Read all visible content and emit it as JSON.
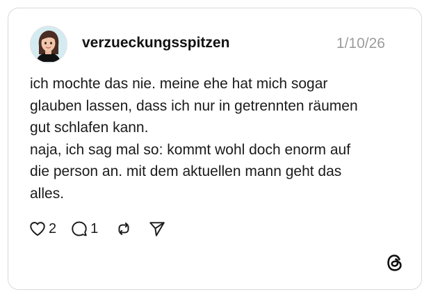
{
  "post": {
    "author": {
      "username": "verzueckungsspitzen",
      "avatar_icon": "memoji-avatar"
    },
    "date": "1/10/26",
    "text_lines": [
      "ich mochte das nie. meine ehe hat mich sogar",
      "glauben lassen, dass ich nur in getrennten räumen",
      "gut schlafen kann.",
      "naja, ich sag mal so: kommt wohl doch enorm auf",
      "die person an. mit dem aktuellen mann geht das",
      "alles."
    ],
    "actions": {
      "like_count": "2",
      "reply_count": "1",
      "like_icon": "heart-icon",
      "reply_icon": "comment-icon",
      "repost_icon": "repost-icon",
      "share_icon": "send-icon"
    },
    "branding": {
      "logo_icon": "threads-logo-icon"
    }
  }
}
